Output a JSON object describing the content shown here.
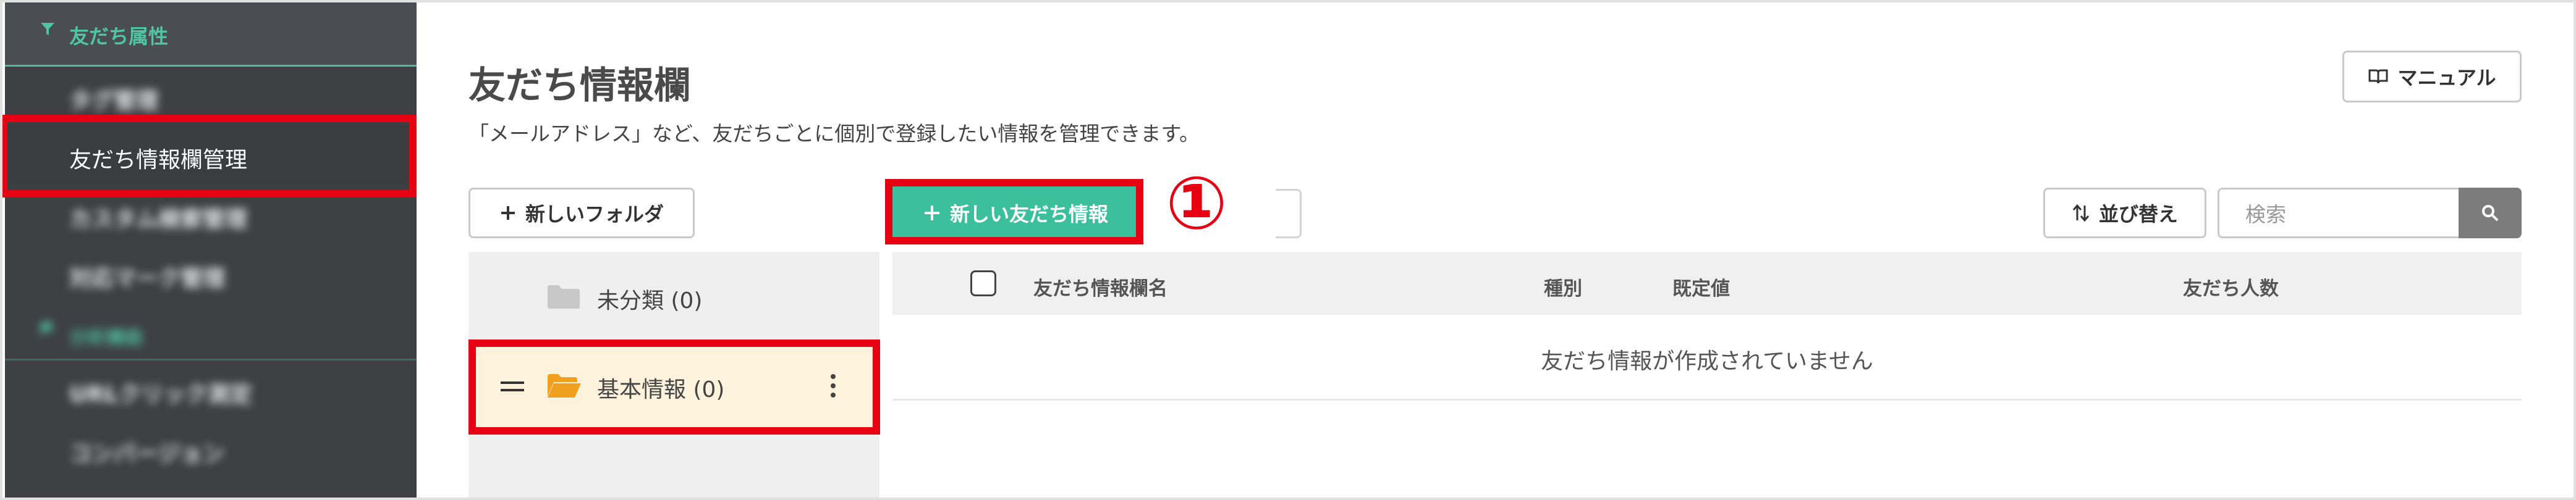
{
  "sidebar": {
    "section_label": "友だち属性",
    "items": [
      {
        "label": "タグ管理"
      },
      {
        "label": "友だち情報欄管理"
      },
      {
        "label": "カスタム検索管理"
      },
      {
        "label": "対応マーク管理"
      },
      {
        "label": "URLクリック測定"
      },
      {
        "label": "コンバージョン"
      }
    ],
    "group_label": "分析機能"
  },
  "header": {
    "title": "友だち情報欄",
    "description": "「メールアドレス」など、友だちごとに個別で登録したい情報を管理できます。",
    "manual_label": "マニュアル"
  },
  "toolbar": {
    "new_folder_label": "新しいフォルダ",
    "new_info_label": "新しい友だち情報",
    "sort_label": "並び替え",
    "search_placeholder": "検索",
    "annotation_number": "①"
  },
  "folders": [
    {
      "name": "未分類 (0)",
      "selected": false
    },
    {
      "name": "基本情報 (0)",
      "selected": true
    }
  ],
  "table": {
    "columns": [
      "友だち情報欄名",
      "種別",
      "既定値",
      "友だち人数"
    ],
    "empty_message": "友だち情報が作成されていません"
  },
  "colors": {
    "accent": "#3bbf9c",
    "highlight": "#e60012",
    "sidebar_bg": "#3d3f43",
    "folder_icon": "#f0a01e"
  }
}
